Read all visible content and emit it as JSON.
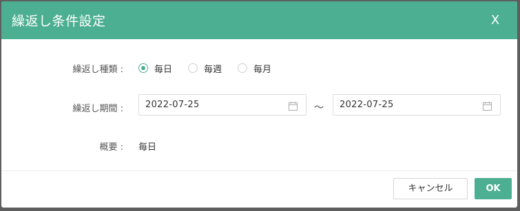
{
  "dialog": {
    "title": "繰返し条件設定",
    "close_label": "X"
  },
  "form": {
    "repeat_type_label": "繰返し種類 :",
    "repeat_options": [
      {
        "label": "毎日",
        "checked": true
      },
      {
        "label": "毎週",
        "checked": false
      },
      {
        "label": "毎月",
        "checked": false
      }
    ],
    "period_label": "繰返し期間 :",
    "start_date": "2022-07-25",
    "separator": "～",
    "end_date": "2022-07-25",
    "summary_label": "概要 :",
    "summary_value": "毎日"
  },
  "footer": {
    "cancel_label": "キャンセル",
    "ok_label": "OK"
  },
  "colors": {
    "accent": "#4caf91",
    "overlay": "#5e5e5e"
  }
}
